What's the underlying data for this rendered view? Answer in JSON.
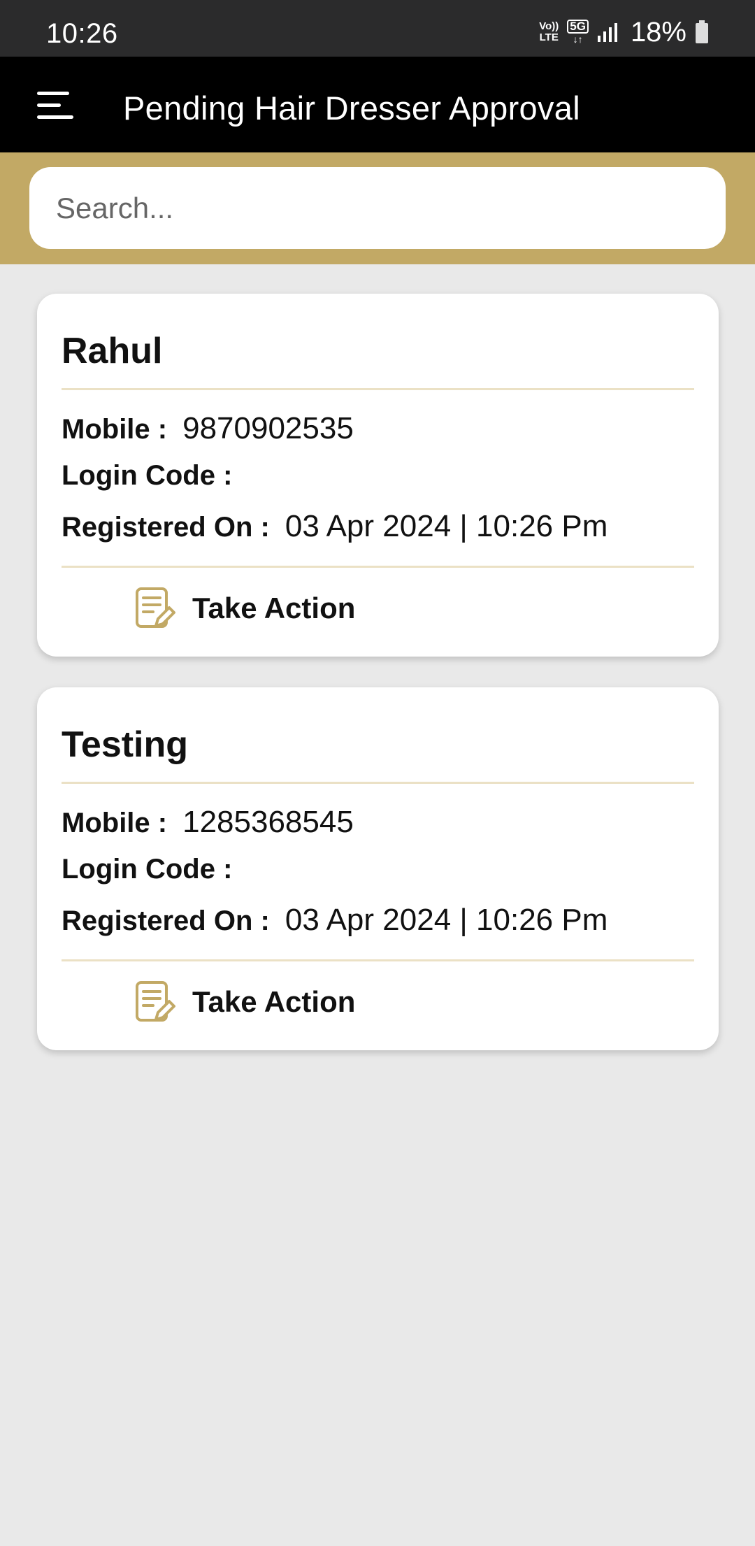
{
  "status_bar": {
    "time": "10:26",
    "volte_line1": "Vo))",
    "volte_line2": "LTE",
    "network": "5G",
    "battery": "18%"
  },
  "app_bar": {
    "title": "Pending Hair Dresser Approval",
    "menu_icon": "hamburger-menu-icon"
  },
  "search": {
    "placeholder": "Search...",
    "value": ""
  },
  "colors": {
    "accent_gold": "#c2a965",
    "app_bar_bg": "#000000",
    "page_bg": "#e9e9e9"
  },
  "labels": {
    "mobile": "Mobile :",
    "login_code": "Login Code :",
    "registered_on": "Registered On :",
    "take_action": "Take Action"
  },
  "hairdressers": [
    {
      "name": "Rahul",
      "mobile": "9870902535",
      "login_code": "",
      "registered_on": "03 Apr 2024 | 10:26 Pm"
    },
    {
      "name": "Testing",
      "mobile": "1285368545",
      "login_code": "",
      "registered_on": "03 Apr 2024 | 10:26 Pm"
    }
  ]
}
